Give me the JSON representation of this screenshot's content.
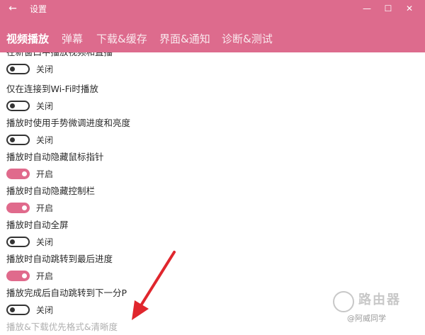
{
  "window": {
    "title": "设置",
    "back_icon": "←",
    "minimize_icon": "—",
    "maximize_icon": "☐",
    "close_icon": "✕"
  },
  "tabs": [
    {
      "label": "视频播放",
      "active": true
    },
    {
      "label": "弹幕",
      "active": false
    },
    {
      "label": "下载&缓存",
      "active": false
    },
    {
      "label": "界面&通知",
      "active": false
    },
    {
      "label": "诊断&测试",
      "active": false
    }
  ],
  "settings": [
    {
      "title": "在新窗口中播放视频和直播",
      "state": "关闭",
      "on": false
    },
    {
      "title": "仅在连接到Wi-Fi时播放",
      "state": "关闭",
      "on": false
    },
    {
      "title": "播放时使用手势微调进度和亮度",
      "state": "关闭",
      "on": false
    },
    {
      "title": "播放时自动隐藏鼠标指针",
      "state": "开启",
      "on": true
    },
    {
      "title": "播放时自动隐藏控制栏",
      "state": "开启",
      "on": true
    },
    {
      "title": "播放时自动全屏",
      "state": "关闭",
      "on": false
    },
    {
      "title": "播放时自动跳转到最后进度",
      "state": "开启",
      "on": true
    },
    {
      "title": "播放完成后自动跳转到下一分P",
      "state": "关闭",
      "on": false
    },
    {
      "title": "播放&下载优先格式&清晰度"
    }
  ],
  "colors": {
    "accent": "#dd6b8d",
    "toggle_on": "#e06a8c",
    "arrow": "#e0262d"
  },
  "watermark": {
    "name": "路由器",
    "sub": "@阿威同学"
  }
}
